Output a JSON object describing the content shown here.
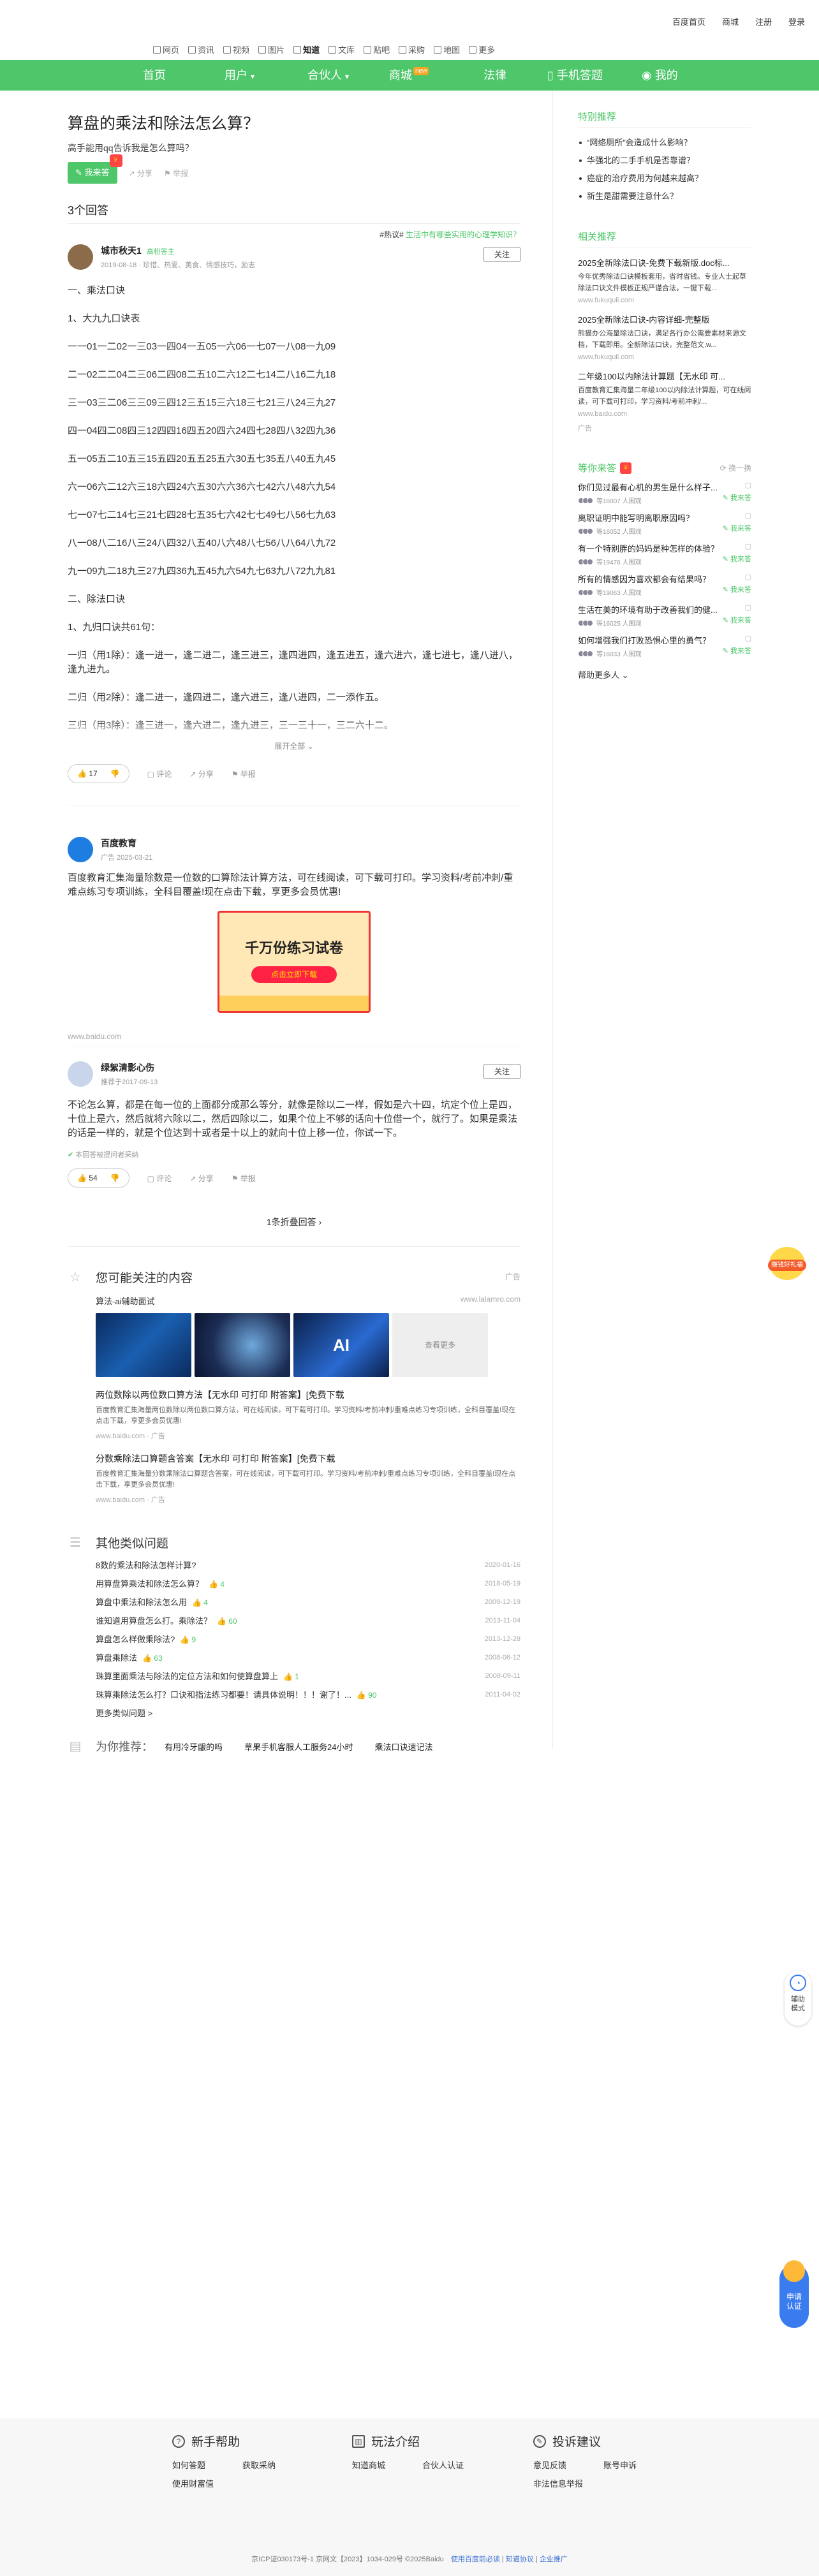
{
  "top_links": [
    "百度首页",
    "商城",
    "注册",
    "登录"
  ],
  "channels": [
    {
      "label": "网页",
      "on": false
    },
    {
      "label": "资讯",
      "on": false
    },
    {
      "label": "视频",
      "on": false
    },
    {
      "label": "图片",
      "on": false
    },
    {
      "label": "知道",
      "on": true
    },
    {
      "label": "文库",
      "on": false
    },
    {
      "label": "贴吧",
      "on": false
    },
    {
      "label": "采购",
      "on": false
    },
    {
      "label": "地图",
      "on": false
    },
    {
      "label": "更多",
      "on": false
    }
  ],
  "nav": {
    "home": "首页",
    "user": "用户",
    "partner": "合伙人",
    "mall": "商城",
    "mall_badge": "new",
    "law": "法律",
    "mobile": "手机答题",
    "me": "我的"
  },
  "question": {
    "title": "算盘的乘法和除法怎么算？",
    "desc": "高手能用qq告诉我是怎么算吗？",
    "answer_btn": "我来答",
    "share": "分享",
    "report": "举报"
  },
  "answer_count": "3个回答",
  "hot_tip": {
    "label": "#热议#",
    "text": "生活中有哪些实用的心理学知识？"
  },
  "answer1": {
    "name": "城市秋天1",
    "tag": "高粉答主",
    "meta": "2019-08-18 · 珍惜、热爱、美食、情感技巧，励志",
    "follow": "关注",
    "lines": [
      "一、乘法口诀",
      "1、大九九口诀表",
      "一一01一二02一三03一四04一五05一六06一七07一八08一九09",
      "二一02二二04二三06二四08二五10二六12二七14二八16二九18",
      "三一03三二06三三09三四12三五15三六18三七21三八24三九27",
      "四一04四二08四三12四四16四五20四六24四七28四八32四九36",
      "五一05五二10五三15五四20五五25五六30五七35五八40五九45",
      "六一06六二12六三18六四24六五30六六36六七42六八48六九54",
      "七一07七二14七三21七四28七五35七六42七七49七八56七九63",
      "八一08八二16八三24八四32八五40八六48八七56八八64八九72",
      "九一09九二18九三27九四36九五45九六54九七63九八72九九81",
      "二、除法口诀",
      "1、九归口诀共61句：",
      "一归（用1除）：逢一进一，逢二进二，逢三进三，逢四进四，逢五进五，逢六进六，逢七进七，逢八进八，逢九进九。",
      "二归（用2除）：逢二进一，逢四进二，逢六进三，逢八进四，二一添作五。",
      "三归（用3除）：逢三进一，逢六进二，逢九进三，三一三十一，三二六十二。"
    ],
    "expand": "展开全部",
    "likes": "17",
    "comment": "评论",
    "share": "分享",
    "report": "举报"
  },
  "ad": {
    "name": "百度教育",
    "meta": "广告    2025-03-21",
    "text": "百度教育汇集海量除数是一位数的口算除法计算方法，可在线阅读，可下载可打印。学习资料/考前冲刺/重难点练习专项训练，全科目覆盖!现在点击下载，享更多会员优惠!",
    "img_title": "千万份练习试卷",
    "img_btn": "点击立即下载",
    "source": "www.baidu.com"
  },
  "answer2": {
    "name": "绿絮清影心伤",
    "meta": "推荐于2017-09-13",
    "follow": "关注",
    "text": "不论怎么算，都是在每一位的上面都分成那么等分，就像是除以二一样，假如是六十四，坑定个位上是四，十位上是六，然后就将六除以二，然后四除以二，如果个位上不够的话向十位借一个，就行了。如果是乘法的话是一样的，就是个位达到十或者是十以上的就向十位上移一位，你试一下。",
    "badge": "本回答被提问者采纳",
    "likes": "54",
    "comment": "评论",
    "share": "分享",
    "report": "举报"
  },
  "fold": "1条折叠回答",
  "follow_sec": {
    "title": "您可能关注的内容",
    "ad_tag": "广告",
    "sub": "算法-ai辅助面试",
    "url": "www.lalamro.com",
    "img_ai": "AI",
    "img_more": "查看更多",
    "items": [
      {
        "t": "两位数除以两位数口算方法【无水印 可打印 附答案】[免费下载",
        "d": "百度教育汇集海量两位数除以两位数口算方法，可在线阅读，可下载可打印。学习资料/考前冲刺/重难点练习专项训练，全科目覆盖!现在点击下载，享更多会员优惠!",
        "u": "www.baidu.com"
      },
      {
        "t": "分数乘除法口算题含答案【无水印 可打印 附答案】[免费下载",
        "d": "百度教育汇集海量分数乘除法口算题含答案，可在线阅读，可下载可打印。学习资料/考前冲刺/重难点练习专项训练，全科目覆盖!现在点击下载，享更多会员优惠!",
        "u": "www.baidu.com"
      }
    ]
  },
  "other_q": {
    "title": "其他类似问题",
    "items": [
      {
        "q": "8数的乘法和除法怎样计算?",
        "n": "",
        "d": "2020-01-16"
      },
      {
        "q": "用算盘算乘法和除法怎么算？",
        "n": "4",
        "d": "2018-05-19"
      },
      {
        "q": "算盘中乘法和除法怎么用",
        "n": "4",
        "d": "2009-12-19"
      },
      {
        "q": "谁知道用算盘怎么打。乘除法？",
        "n": "60",
        "d": "2013-11-04"
      },
      {
        "q": "算盘怎么样做乘除法?",
        "n": "9",
        "d": "2013-12-28"
      },
      {
        "q": "算盘乘除法",
        "n": "63",
        "d": "2008-06-12"
      },
      {
        "q": "珠算里面乘法与除法的定位方法和如何使算盘算上",
        "n": "1",
        "d": "2008-09-11"
      },
      {
        "q": "珠算乘除法怎么打？口诀和指法练习都要！请具体说明！！！谢了！...",
        "n": "90",
        "d": "2011-04-02"
      }
    ],
    "more": "更多类似问题 >"
  },
  "for_you": {
    "label": "为你推荐：",
    "items": [
      "有用冷牙龈的吗",
      "草果手机客服人工服务24小时",
      "乘法口诀速记法"
    ]
  },
  "side": {
    "special_title": "特别推荐",
    "special": [
      "“网络厕所”会造成什么影响？",
      "华强北的二手手机是否靠谱？",
      "癌症的治疗费用为何越来越高？",
      "新生是甜需要注意什么？"
    ],
    "related_title": "相关推荐",
    "ads": [
      {
        "t": "2025全新除法口诀-免费下载新版.doc标...",
        "d": "今年优秀除法口诀模板套用，省时省钱。专业人士起草除法口诀文件模板正规严谨合法，一键下载...",
        "u": "www.fukuquil.com"
      },
      {
        "t": "2025全新除法口诀-内容详细-完整版",
        "d": "熊猫办公海量除法口诀，满足各行办公需要素材来源文档，下载即用。全新除法口诀，完整范文,w...",
        "u": "www.fukuquil.com"
      },
      {
        "t": "二年级100以内除法计算题【无水印 可...",
        "d": "百度教育汇集海量二年级100以内除法计算题，可在线阅读，可下载可打印，学习资料/考前冲刺/...",
        "u": "www.baidu.com"
      }
    ],
    "ad_label": "广告",
    "guess_title": "等你来答",
    "change": "换一换",
    "guess": [
      {
        "q": "你们见过最有心机的男生是什么样子...",
        "c": "等16007 人围观",
        "a": "我来答"
      },
      {
        "q": "离职证明中能写明离职原因吗？",
        "c": "等16052 人围观",
        "a": "我来答"
      },
      {
        "q": "有一个特别胖的妈妈是种怎样的体验？",
        "c": "等19476 人围观",
        "a": "我来答"
      },
      {
        "q": "所有的情感因为喜欢都会有结果吗？",
        "c": "等19063 人围观",
        "a": "我来答"
      },
      {
        "q": "生活在美的环境有助于改善我们的健...",
        "c": "等16025 人围观",
        "a": "我来答"
      },
      {
        "q": "如何增强我们打败恐惧心里的勇气？",
        "c": "等16033 人围观",
        "a": "我来答"
      }
    ],
    "help_more": "帮助更多人"
  },
  "float": {
    "promo": "赚钱好礼福",
    "assist": "辅助模式",
    "ask": "申请认证"
  },
  "footer": {
    "cols": [
      {
        "h": "新手帮助",
        "links": [
          "如何答题",
          "获取采纳",
          "使用财富值"
        ]
      },
      {
        "h": "玩法介绍",
        "links": [
          "知道商城",
          "合伙人认证"
        ]
      },
      {
        "h": "投诉建议",
        "links": [
          "意见反馈",
          "账号申诉",
          "非法信息举报"
        ]
      }
    ],
    "bottom": "京ICP证030173号-1    京网文【2023】1034-029号    ©2025Baidu",
    "bottom_links": [
      "使用百度前必读",
      "知道协议",
      "企业推广"
    ]
  }
}
